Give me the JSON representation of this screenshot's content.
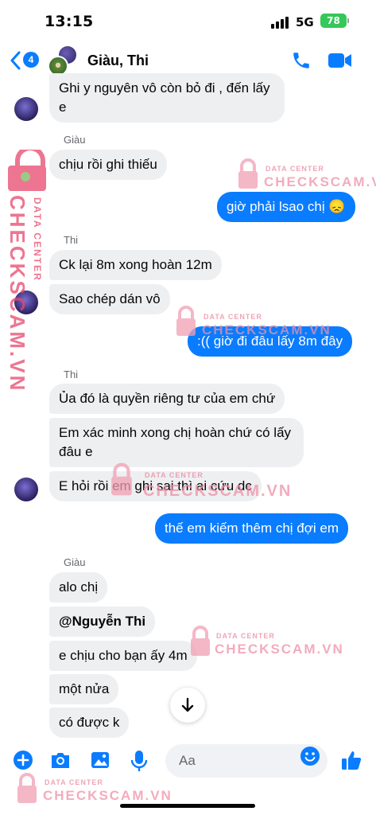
{
  "status_bar": {
    "time": "13:15",
    "network": "5G",
    "battery": "78"
  },
  "header": {
    "back_count": "4",
    "title": "Giàu, Thi"
  },
  "messages": [
    {
      "text": "Ghi y nguyên vô còn bỏ đi , đến lấy e"
    },
    {
      "sender": "Giàu"
    },
    {
      "text": "chịu rồi ghi thiếu"
    },
    {
      "text": "giờ phải lsao chị 😞"
    },
    {
      "sender": "Thi"
    },
    {
      "text": "Ck lại 8m xong hoàn 12m"
    },
    {
      "text": "Sao chép dán vô"
    },
    {
      "text": ":(( giờ đi đâu lấy 8m đây"
    },
    {
      "sender": "Thi"
    },
    {
      "text": "Ủa đó là quyền riêng tư của em chứ"
    },
    {
      "text": "Em xác minh xong chị hoàn chứ có lấy đâu e"
    },
    {
      "text": "E hỏi rồi em ghi sai thì ai cứu dc"
    },
    {
      "text": "thế em kiếm thêm chị đợi em"
    },
    {
      "sender": "Giàu"
    },
    {
      "text": "alo chị"
    },
    {
      "text": "@Nguyễn Thi"
    },
    {
      "text": "e chịu cho bạn ấy 4m"
    },
    {
      "text": "một nửa"
    },
    {
      "text": "có được k"
    }
  ],
  "watermark": {
    "small": "DATA CENTER",
    "big": "CHECKSCAM.VN"
  },
  "composer": {
    "placeholder": "Aa"
  },
  "icons": {
    "back": "chevron-left-icon",
    "call": "phone-icon",
    "video": "video-camera-icon",
    "plus": "plus-circle-icon",
    "camera": "camera-icon",
    "gallery": "image-icon",
    "mic": "microphone-icon",
    "emoji": "smiley-icon",
    "like": "thumbs-up-icon",
    "scroll": "arrow-down-icon"
  },
  "colors": {
    "accent": "#0a7cff",
    "incoming_bubble": "#eeeff1",
    "battery": "#35c759",
    "watermark": "#e8476d"
  }
}
